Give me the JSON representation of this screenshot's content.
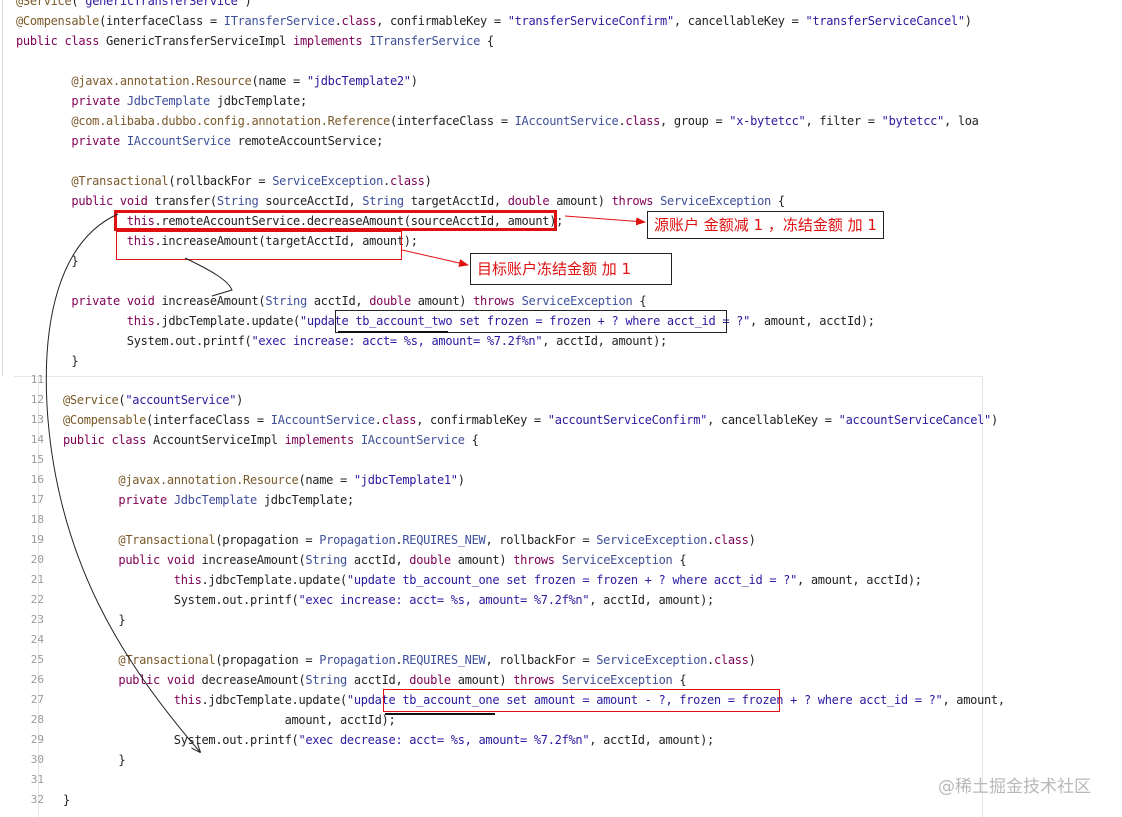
{
  "top_code": {
    "lines": [
      "@Service(\"genericTransferService\")",
      "@Compensable(interfaceClass = ITransferService.class, confirmableKey = \"transferServiceConfirm\", cancellableKey = \"transferServiceCancel\")",
      "public class GenericTransferServiceImpl implements ITransferService {",
      "",
      "        @javax.annotation.Resource(name = \"jdbcTemplate2\")",
      "        private JdbcTemplate jdbcTemplate;",
      "        @com.alibaba.dubbo.config.annotation.Reference(interfaceClass = IAccountService.class, group = \"x-bytetcc\", filter = \"bytetcc\", loa",
      "        private IAccountService remoteAccountService;",
      "",
      "        @Transactional(rollbackFor = ServiceException.class)",
      "        public void transfer(String sourceAcctId, String targetAcctId, double amount) throws ServiceException {",
      "                this.remoteAccountService.decreaseAmount(sourceAcctId, amount);",
      "                this.increaseAmount(targetAcctId, amount);",
      "        }",
      "",
      "        private void increaseAmount(String acctId, double amount) throws ServiceException {",
      "                this.jdbcTemplate.update(\"update tb_account_two set frozen = frozen + ? where acct_id = ?\", amount, acctId);",
      "                System.out.printf(\"exec increase: acct= %s, amount= %7.2f%n\", acctId, amount);",
      "        }"
    ]
  },
  "bottom_code": {
    "line_numbers": [
      "11",
      "12",
      "13",
      "14",
      "15",
      "16",
      "17",
      "18",
      "19",
      "20",
      "21",
      "22",
      "23",
      "24",
      "25",
      "26",
      "27",
      "28",
      "29",
      "30",
      "31",
      "32"
    ],
    "lines": [
      "",
      "@Service(\"accountService\")",
      "@Compensable(interfaceClass = IAccountService.class, confirmableKey = \"accountServiceConfirm\", cancellableKey = \"accountServiceCancel\")",
      "public class AccountServiceImpl implements IAccountService {",
      "",
      "        @javax.annotation.Resource(name = \"jdbcTemplate1\")",
      "        private JdbcTemplate jdbcTemplate;",
      "",
      "        @Transactional(propagation = Propagation.REQUIRES_NEW, rollbackFor = ServiceException.class)",
      "        public void increaseAmount(String acctId, double amount) throws ServiceException {",
      "                this.jdbcTemplate.update(\"update tb_account_one set frozen = frozen + ? where acct_id = ?\", amount, acctId);",
      "                System.out.printf(\"exec increase: acct= %s, amount= %7.2f%n\", acctId, amount);",
      "        }",
      "",
      "        @Transactional(propagation = Propagation.REQUIRES_NEW, rollbackFor = ServiceException.class)",
      "        public void decreaseAmount(String acctId, double amount) throws ServiceException {",
      "                this.jdbcTemplate.update(\"update tb_account_one set amount = amount - ?, frozen = frozen + ? where acct_id = ?\", amount,",
      "                                amount, acctId);",
      "                System.out.printf(\"exec decrease: acct= %s, amount= %7.2f%n\", acctId, amount);",
      "        }",
      "",
      "}"
    ]
  },
  "annotations": {
    "label_source": "源账户 金额减 1 ，冻结金额 加 1",
    "label_target": "目标账户冻结金额 加 1"
  },
  "colors": {
    "highlight_red": "#e01010",
    "annotation": "#7a5a2a",
    "keyword": "#7f0055",
    "string": "#2a1aa0"
  },
  "watermark": "@稀土掘金技术社区"
}
